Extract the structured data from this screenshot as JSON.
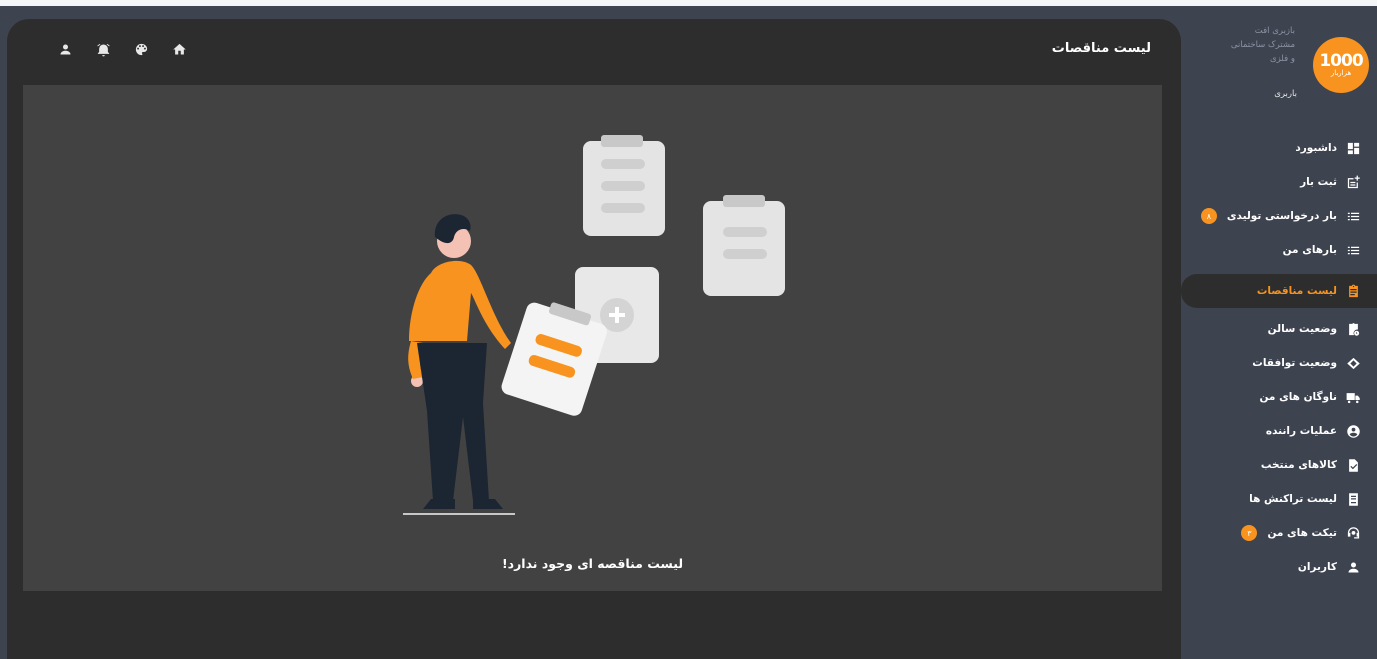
{
  "header": {
    "title": "لیست مناقصات",
    "icons": [
      "home-icon",
      "palette-icon",
      "alarm-icon",
      "user-icon"
    ]
  },
  "empty_state": {
    "message": "لیست مناقصه ای وجود ندارد!"
  },
  "profile": {
    "name_line1": "بازبری افت",
    "name_line2": "مشترک ساختمانی",
    "name_line3": "و فلزی",
    "role": "باربری",
    "logo_big": "1000",
    "logo_small": "هزاربار",
    "accent_color": "#f7931e"
  },
  "sidebar": {
    "items": [
      {
        "label": "داشبورد",
        "icon": "dashboard-icon"
      },
      {
        "label": "ثبت بار",
        "icon": "post-add-icon"
      },
      {
        "label": "بار درخواستی تولیدی",
        "icon": "list-icon",
        "badge": "۸"
      },
      {
        "label": "بارهای من",
        "icon": "list-icon"
      },
      {
        "label": "لیست مناقصات",
        "icon": "assignment-icon",
        "active": true
      },
      {
        "label": "وضعیت سالن",
        "icon": "clipboard-clock-icon"
      },
      {
        "label": "وضعیت توافقات",
        "icon": "handshake-icon"
      },
      {
        "label": "ناوگان های من",
        "icon": "truck-icon"
      },
      {
        "label": "عملیات راننده",
        "icon": "account-circle-icon"
      },
      {
        "label": "کالاهای منتخب",
        "icon": "file-check-icon"
      },
      {
        "label": "لیست تراکنش ها",
        "icon": "receipt-icon"
      },
      {
        "label": "تیکت های من",
        "icon": "support-agent-icon",
        "badge": "۳"
      },
      {
        "label": "کاربران",
        "icon": "person-icon"
      }
    ]
  }
}
